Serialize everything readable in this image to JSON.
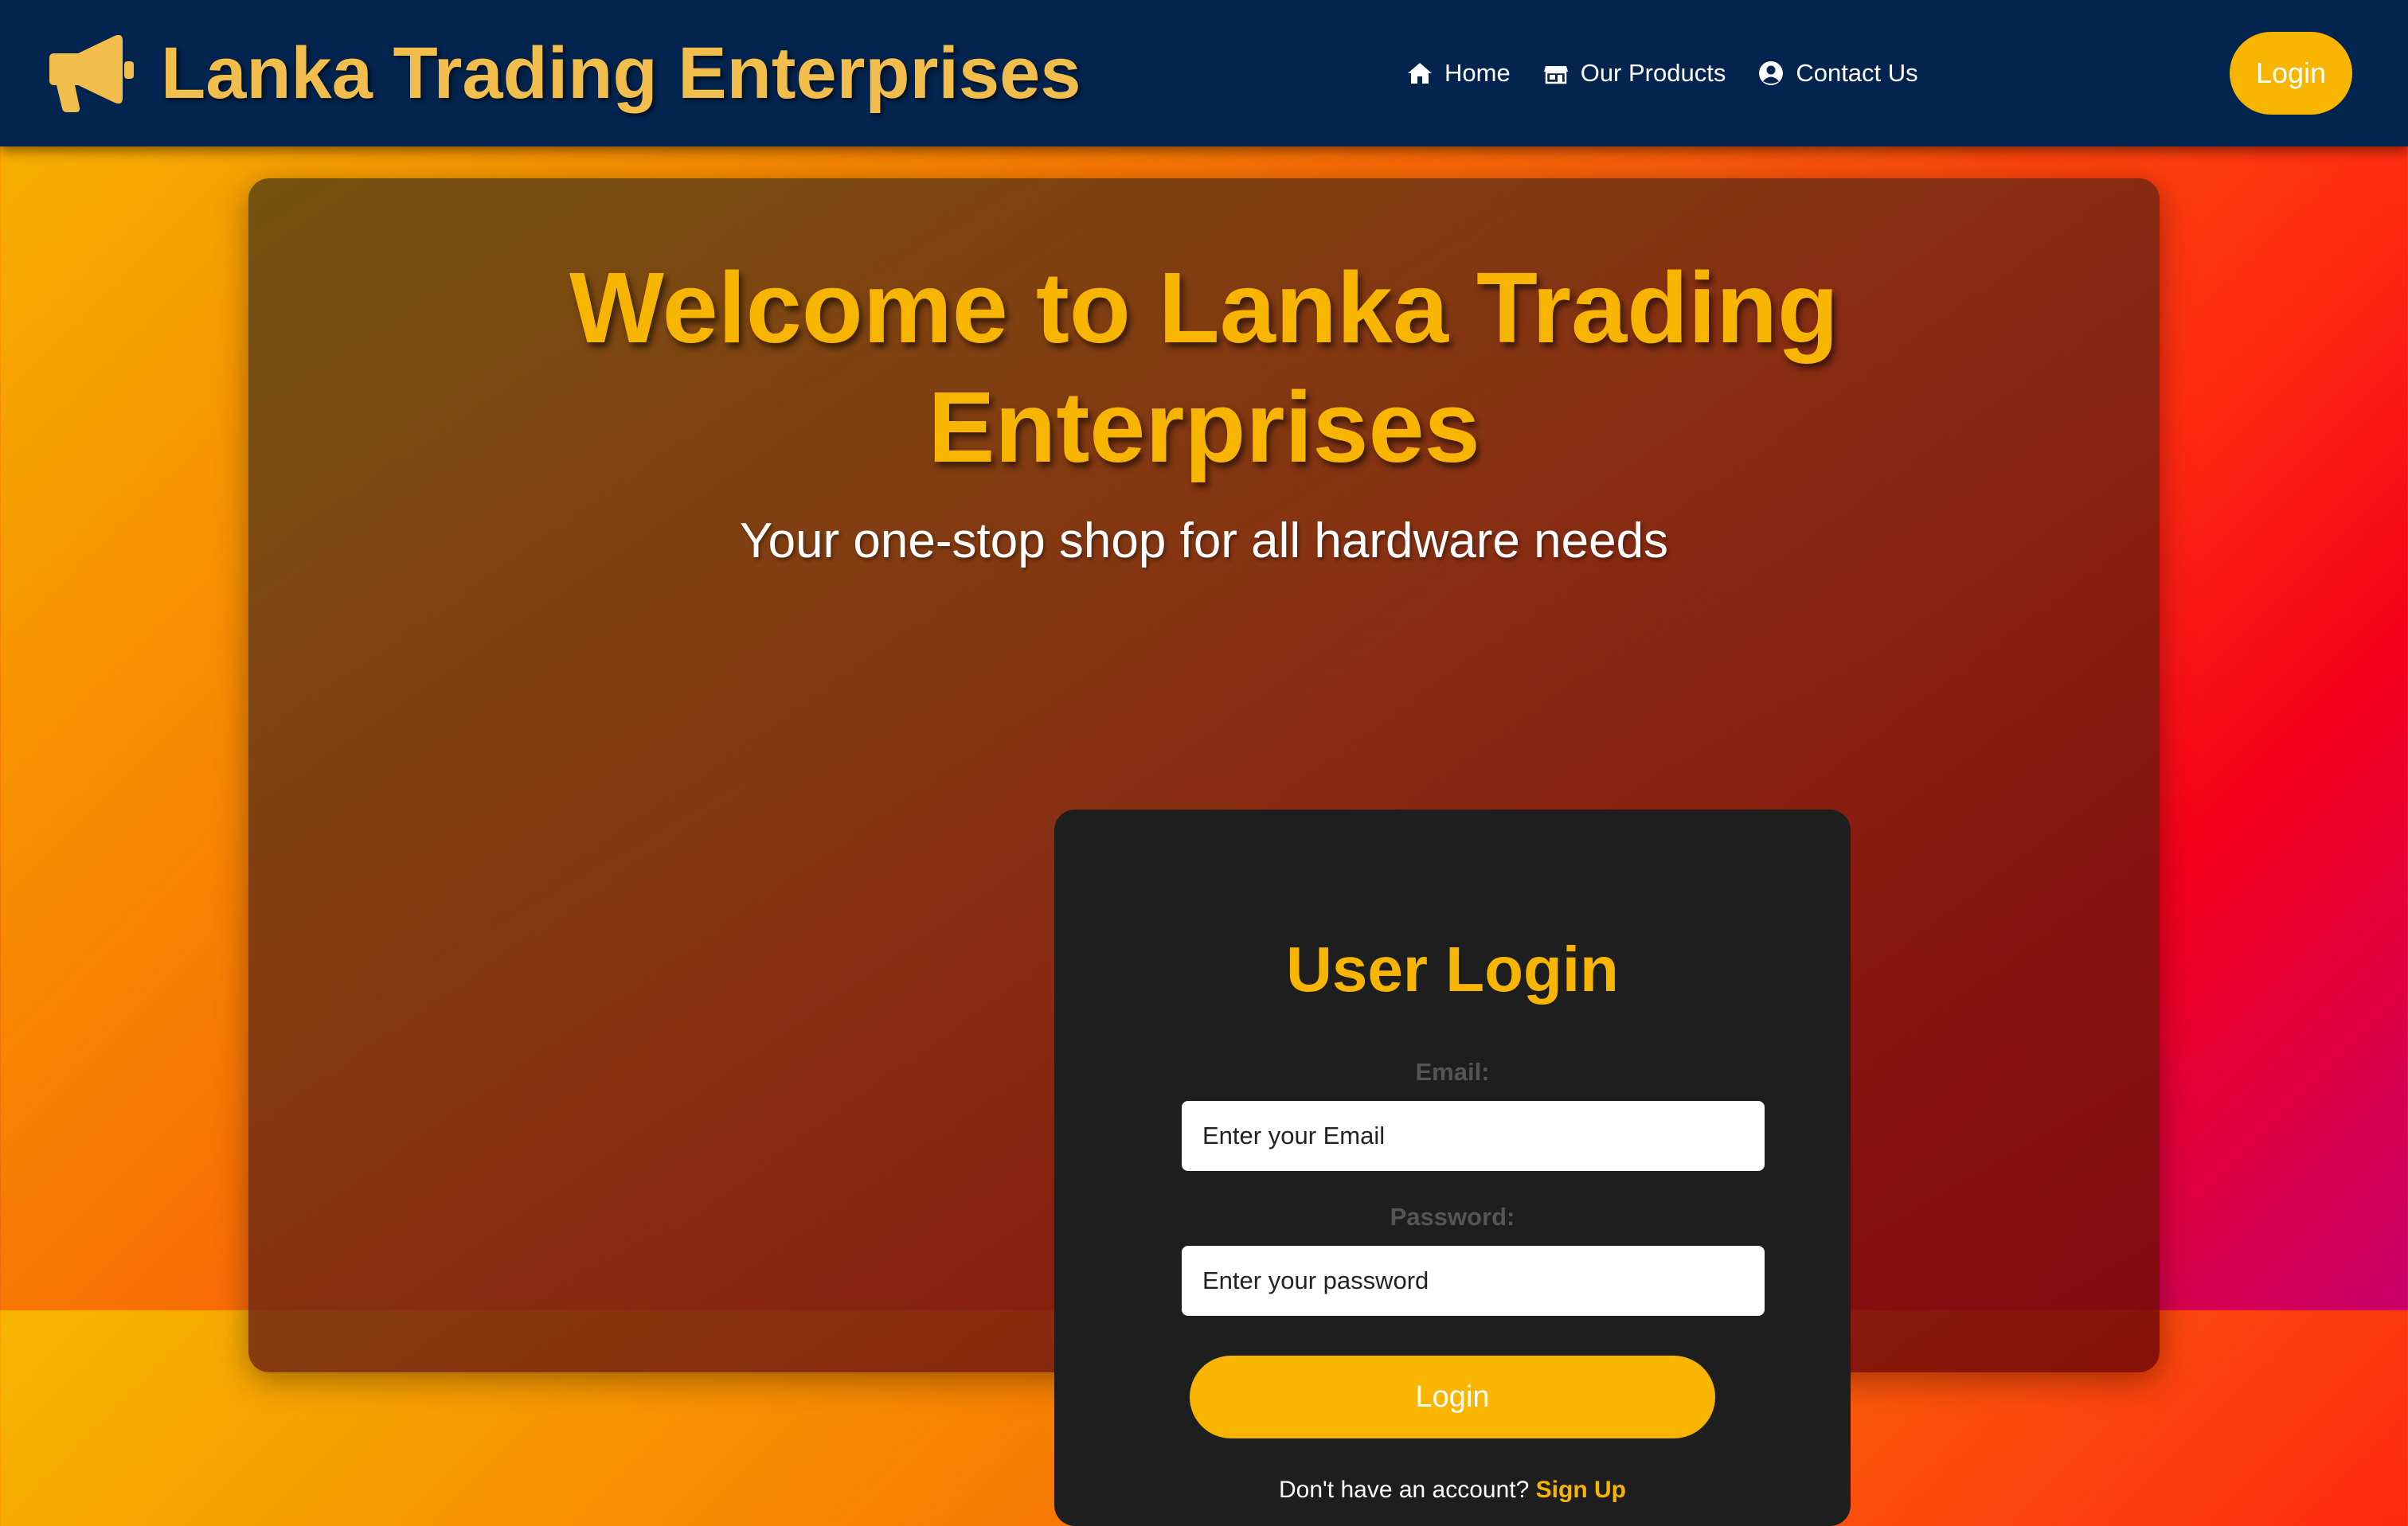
{
  "header": {
    "brand_title": "Lanka Trading Enterprises",
    "brand_icon": "megaphone-icon",
    "nav": [
      {
        "label": "Home",
        "icon": "home-icon"
      },
      {
        "label": "Our Products",
        "icon": "store-icon"
      },
      {
        "label": "Contact Us",
        "icon": "user-circle-icon"
      }
    ],
    "login_label": "Login"
  },
  "hero": {
    "title": "Welcome to Lanka Trading Enterprises",
    "subtitle": "Your one-stop shop for all hardware needs"
  },
  "login_form": {
    "title": "User Login",
    "email_label": "Email:",
    "email_placeholder": "Enter your Email",
    "password_label": "Password:",
    "password_placeholder": "Enter your password",
    "submit_label": "Login",
    "signup_prompt": "Don't have an account?",
    "signup_link": "Sign Up"
  },
  "colors": {
    "navbar": "#03244e",
    "accent": "#f7b500",
    "brand_text": "#f1bd4c",
    "panel": "#1e1e1e"
  }
}
